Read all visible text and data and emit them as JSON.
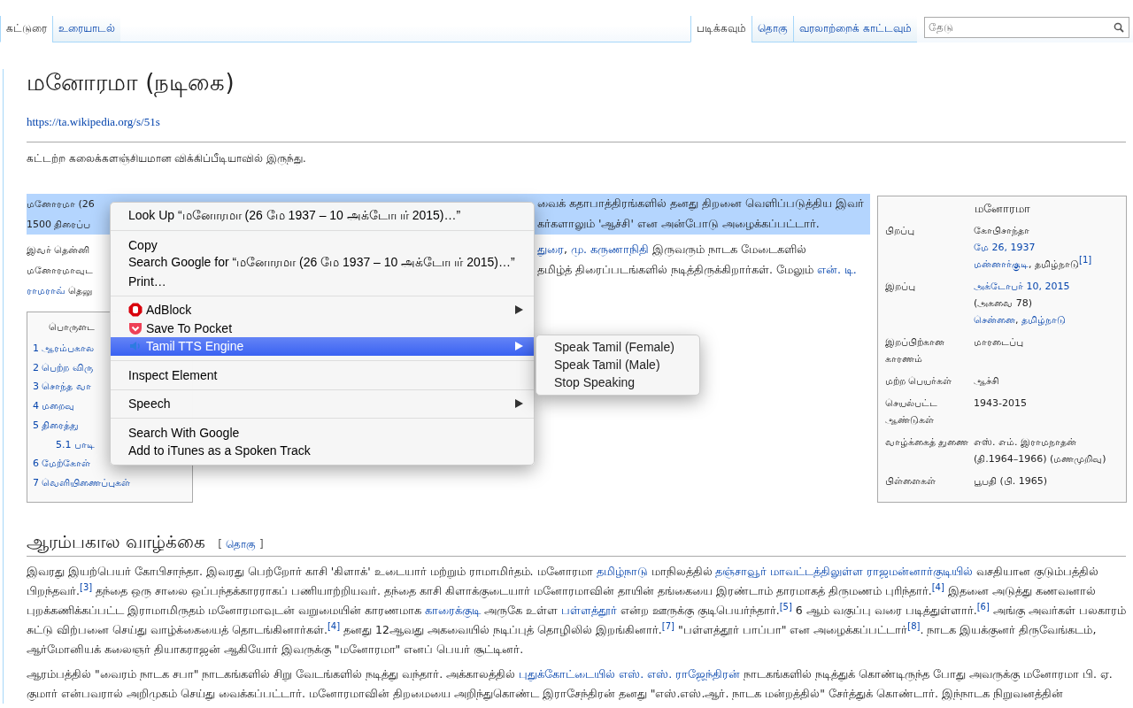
{
  "tabs_left": [
    {
      "label": "கட்டுரை",
      "selected": true
    },
    {
      "label": "உரையாடல்",
      "selected": false
    }
  ],
  "tabs_right": [
    {
      "label": "படிக்கவும்",
      "selected": true
    },
    {
      "label": "தொகு",
      "selected": false
    },
    {
      "label": "வரலாற்றைக் காட்டவும்",
      "selected": false
    }
  ],
  "search": {
    "placeholder": "தேடு"
  },
  "title": "மனோரமா (நடிகை)",
  "short_url": "https://ta.wikipedia.org/s/51s",
  "tagline": "கட்டற்ற கலைக்களஞ்சியமான விக்கிப்பீடியாவில் இருந்து.",
  "intro": [
    {
      "selected": true,
      "lines": [
        {
          "before": [
            {
              "kind": "plain",
              "text": "மனோரமா (26"
            }
          ],
          "after": [
            {
              "kind": "plain",
              "text": "வைக் கதாபாத்திரங்களில் தனது திறனை வெளிப்படுத்திய இவர்"
            }
          ]
        },
        {
          "before": [
            {
              "kind": "plain",
              "text": "1500 திரைப்ப"
            }
          ],
          "after": [
            {
              "kind": "plain",
              "text": "கர்களாலும் 'ஆச்சி' என அன்போடு அழைக்கப்பட்டார்."
            }
          ]
        }
      ]
    },
    {
      "selected": false,
      "lines": [
        {
          "before": [
            {
              "kind": "plain",
              "text": "இவர் தென்னி"
            }
          ],
          "after": [
            {
              "kind": "link",
              "text": "துரை"
            },
            {
              "kind": "plain",
              "text": ", "
            },
            {
              "kind": "link",
              "text": "மு. கருணாநிதி"
            },
            {
              "kind": "plain",
              "text": " இருவரும் நாடக மேடைகளில்"
            }
          ]
        },
        {
          "before": [
            {
              "kind": "plain",
              "text": "மனோரமாவுட"
            }
          ],
          "after": [
            {
              "kind": "plain",
              "text": "தமிழ்த் திரைப்படங்களில் நடித்திருக்கிறார்கள். மேலும் "
            },
            {
              "kind": "link",
              "text": "என். டி."
            }
          ]
        },
        {
          "before": [
            {
              "kind": "link",
              "text": "ராமராவ்"
            },
            {
              "kind": "plain",
              "text": " தெலு"
            }
          ]
        }
      ]
    }
  ],
  "toc": {
    "title": "பொருளட",
    "items": [
      {
        "label": "1 ஆரம்பகால"
      },
      {
        "label": "2 பெற்ற விரு"
      },
      {
        "label": "3 சொந்த வா"
      },
      {
        "label": "4 மறைவு"
      },
      {
        "label": "5 திரைத்து",
        "children": [
          {
            "label": "5.1 பாடி"
          }
        ]
      },
      {
        "label": "6 மேற்கோள்"
      },
      {
        "label": "7 வெளியிணைப்புகள்"
      }
    ]
  },
  "infobox": {
    "title": "மனோரமா",
    "rows": [
      {
        "label": "பிறப்பு",
        "lines": [
          [
            {
              "kind": "plain",
              "text": "கோபிசாந்தா"
            }
          ],
          [
            {
              "kind": "link",
              "text": "மே 26, 1937"
            }
          ],
          [
            {
              "kind": "link",
              "text": "மன்னார்குடி"
            },
            {
              "kind": "plain",
              "text": ", தமிழ்நாடு"
            },
            {
              "kind": "ref",
              "text": "[1]"
            }
          ]
        ]
      },
      {
        "label": "இறப்பு",
        "lines": [
          [
            {
              "kind": "link",
              "text": "அக்டோபர் 10, 2015"
            }
          ],
          [
            {
              "kind": "plain",
              "text": "(அகவை 78)"
            }
          ],
          [
            {
              "kind": "link",
              "text": "சென்னை"
            },
            {
              "kind": "plain",
              "text": ", "
            },
            {
              "kind": "link",
              "text": "தமிழ்நாடு"
            }
          ]
        ]
      },
      {
        "label": "இறப்பிற்கான காரணம்",
        "lines": [
          [
            {
              "kind": "plain",
              "text": "மாரடைப்பு"
            }
          ]
        ]
      },
      {
        "label": "மற்ற பெயர்கள்",
        "lines": [
          [
            {
              "kind": "plain",
              "text": "ஆச்சி"
            }
          ]
        ]
      },
      {
        "label": "செயல்பட்ட ஆண்டுகள்",
        "lines": [
          [
            {
              "kind": "plain",
              "text": "1943-2015"
            }
          ]
        ]
      },
      {
        "label": "வாழ்க்கைத் துணை",
        "lines": [
          [
            {
              "kind": "plain",
              "text": "எஸ். எம். இராமநாதன்"
            }
          ],
          [
            {
              "kind": "plain",
              "text": "(தி.1964–1966) (மணமுறிவு)"
            }
          ]
        ]
      },
      {
        "label": "பிள்ளைகள்",
        "lines": [
          [
            {
              "kind": "plain",
              "text": "பூபதி (பி. 1965)"
            }
          ]
        ]
      }
    ]
  },
  "section": {
    "heading": "ஆரம்பகால வாழ்க்கை",
    "edit": {
      "open": "[",
      "label": "தொகு",
      "close": "]"
    },
    "paragraphs": [
      [
        [
          {
            "kind": "plain",
            "text": "இவரது இயற்பெயர் கோபிசாந்தா. இவரது பெற்றோர் காசி 'கிளாக்' உடையார் மற்றும் ராமாமிர்தம். மனோரமா "
          },
          {
            "kind": "link",
            "text": "தமிழ்நாடு"
          },
          {
            "kind": "plain",
            "text": " மாநிலத்தில் "
          },
          {
            "kind": "link",
            "text": "தஞ்சாவூர் மாவட்டத்திலுள்ள ராஜமன்னார்குடியில்"
          },
          {
            "kind": "plain",
            "text": " வசதியான குடும்பத்தில்"
          }
        ],
        [
          {
            "kind": "plain",
            "text": "பிறந்தவர்."
          },
          {
            "kind": "ref",
            "text": "[3]"
          },
          {
            "kind": "plain",
            "text": " தந்தை ஒரு சாலை ஒப்பந்தக்காரராகப் பணியாற்றியவர். தந்தை காசி கிளாக்குடையார் மனோரமாவின் தாயின் தங்கையை இரண்டாம் தாரமாகத் திருமணம் புரிந்தார்."
          },
          {
            "kind": "ref",
            "text": "[4]"
          },
          {
            "kind": "plain",
            "text": " இதனை அடுத்து கணவனால்"
          }
        ],
        [
          {
            "kind": "plain",
            "text": "புறக்கணிக்கப்பட்ட இராமாமிருதம் மனோரமாவுடன் வறுமையின் காரணமாக "
          },
          {
            "kind": "link",
            "text": "காரைக்குடி"
          },
          {
            "kind": "plain",
            "text": " அருகே உள்ள "
          },
          {
            "kind": "link",
            "text": "பள்ளத்தூர்"
          },
          {
            "kind": "plain",
            "text": " என்ற ஊருக்கு குடிபெயர்ந்தார்."
          },
          {
            "kind": "ref",
            "text": "[5]"
          },
          {
            "kind": "plain",
            "text": " 6 ஆம் வகுப்பு வரை படித்துள்ளார்."
          },
          {
            "kind": "ref",
            "text": "[6]"
          },
          {
            "kind": "plain",
            "text": " அங்கு அவர்கள் பலகாரம்"
          }
        ],
        [
          {
            "kind": "plain",
            "text": "சுட்டு விற்பனை செய்து வாழ்க்கையைத் தொடங்கினார்கள்."
          },
          {
            "kind": "ref",
            "text": "[4]"
          },
          {
            "kind": "plain",
            "text": " தனது 12ஆவது அகவையில் நடிப்புத் தொழிலில் இறங்கினார்."
          },
          {
            "kind": "ref",
            "text": "[7]"
          },
          {
            "kind": "plain",
            "text": " \"பள்ளத்தூர் பாப்பா\" என அழைக்கப்பட்டார்"
          },
          {
            "kind": "ref",
            "text": "[8]"
          },
          {
            "kind": "plain",
            "text": ". நாடக இயக்குனர் திருவேங்கடம்,"
          }
        ],
        [
          {
            "kind": "plain",
            "text": "ஆர்மோனியக் கலைஞர் தியாகராஜன் ஆகியோர் இவருக்கு \"மனோரமா\" எனப் பெயர் சூட்டினர்."
          }
        ]
      ],
      [
        [
          {
            "kind": "plain",
            "text": "ஆரம்பத்தில் \"வைரம் நாடக சபா\" நாடகங்களில் சிறு வேடங்களில் நடித்து வந்தார். அக்காலத்தில் "
          },
          {
            "kind": "link",
            "text": "புதுக்கோட்டையில் எஸ். எஸ். ராஜேந்திரன்"
          },
          {
            "kind": "plain",
            "text": " நாடகங்களில் நடித்துக் கொண்டிருந்த போது அவருக்கு மனோரமா பி. ஏ."
          }
        ],
        [
          {
            "kind": "plain",
            "text": "குமார் என்பவரால் அறிமுகம் செய்து வைக்கப்பட்டார். மனோரமாவின் திறமையை அறிந்துகொண்ட இராசேந்திரன் தனது \"எஸ்.எஸ்.ஆர். நாடக மன்றத்தில்\" சேர்த்துக் கொண்டார். இந்நாடக நிறுவனத்தின்"
          }
        ]
      ]
    ]
  },
  "context_menu": {
    "items": [
      {
        "kind": "item",
        "label": "Look Up “மனோரமா (26 மே 1937 – 10 அக்டோபர் 2015)…”",
        "selected": false,
        "submenu": false
      },
      {
        "kind": "separator"
      },
      {
        "kind": "item",
        "label": "Copy",
        "selected": false,
        "submenu": false
      },
      {
        "kind": "item",
        "label": "Search Google for “மனோரமா (26 மே 1937 – 10 அக்டோபர் 2015)…”",
        "selected": false,
        "submenu": false
      },
      {
        "kind": "item",
        "label": "Print…",
        "selected": false,
        "submenu": false
      },
      {
        "kind": "separator"
      },
      {
        "kind": "item",
        "label": "AdBlock",
        "selected": false,
        "submenu": true
      },
      {
        "kind": "item",
        "label": "Save To Pocket",
        "selected": false,
        "submenu": false
      },
      {
        "kind": "item",
        "label": "Tamil TTS Engine",
        "selected": true,
        "submenu": true
      },
      {
        "kind": "separator"
      },
      {
        "kind": "item",
        "label": "Inspect Element",
        "selected": false,
        "submenu": false
      },
      {
        "kind": "separator"
      },
      {
        "kind": "item",
        "label": "Speech",
        "selected": false,
        "submenu": true
      },
      {
        "kind": "separator"
      },
      {
        "kind": "item",
        "label": "Search With Google",
        "selected": false,
        "submenu": false
      },
      {
        "kind": "item",
        "label": "Add to iTunes as a Spoken Track",
        "selected": false,
        "submenu": false
      }
    ]
  },
  "submenu": {
    "items": [
      "Speak Tamil (Female)",
      "Speak Tamil (Male)",
      "Stop Speaking"
    ]
  }
}
